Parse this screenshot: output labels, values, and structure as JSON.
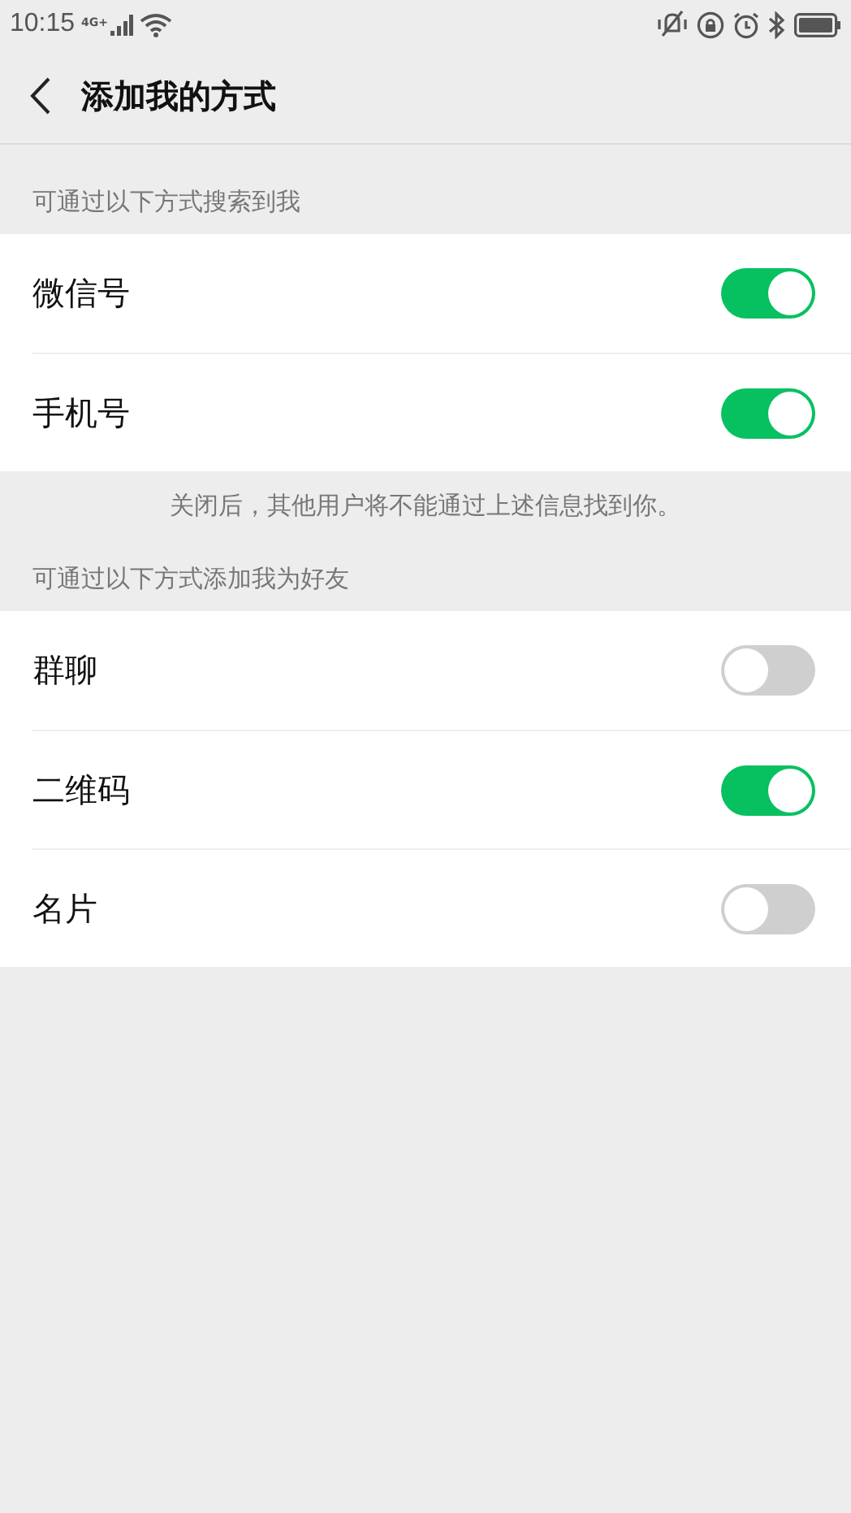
{
  "status_bar": {
    "time": "10:15",
    "network": "4G+"
  },
  "header": {
    "title": "添加我的方式"
  },
  "sections": [
    {
      "label": "可通过以下方式搜索到我",
      "items": [
        {
          "label": "微信号",
          "on": true
        },
        {
          "label": "手机号",
          "on": true
        }
      ],
      "note": "关闭后，其他用户将不能通过上述信息找到你。"
    },
    {
      "label": "可通过以下方式添加我为好友",
      "items": [
        {
          "label": "群聊",
          "on": false
        },
        {
          "label": "二维码",
          "on": true
        },
        {
          "label": "名片",
          "on": false
        }
      ]
    }
  ]
}
